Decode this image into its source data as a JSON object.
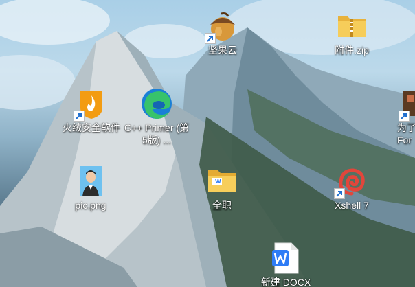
{
  "desktop": {
    "icons": [
      {
        "label": "坚果云",
        "icon": "nutstore-icon",
        "shortcut": true
      },
      {
        "label": "附件.zip",
        "icon": "zip-folder-icon",
        "shortcut": false
      },
      {
        "label": "火绒安全软件",
        "icon": "huorong-security-icon",
        "shortcut": true
      },
      {
        "label": "C++ Primer (第5版) ...",
        "icon": "edge-browser-icon",
        "shortcut": false
      },
      {
        "label": "为了",
        "label2": "For",
        "icon": "app-icon",
        "shortcut": true
      },
      {
        "label": "pic.png",
        "icon": "image-thumbnail-icon",
        "shortcut": false
      },
      {
        "label": "全职",
        "icon": "folder-icon",
        "shortcut": false
      },
      {
        "label": "Xshell 7",
        "icon": "xshell-icon",
        "shortcut": true
      },
      {
        "label": "新建 DOCX",
        "icon": "wps-doc-icon",
        "shortcut": false
      }
    ]
  },
  "colors": {
    "folder": "#f2c14e",
    "shortcut_arrow": "#1f6fd0",
    "wps_blue": "#2e7cf6",
    "huorong_orange": "#f39c12",
    "xshell_red": "#e2463b"
  }
}
